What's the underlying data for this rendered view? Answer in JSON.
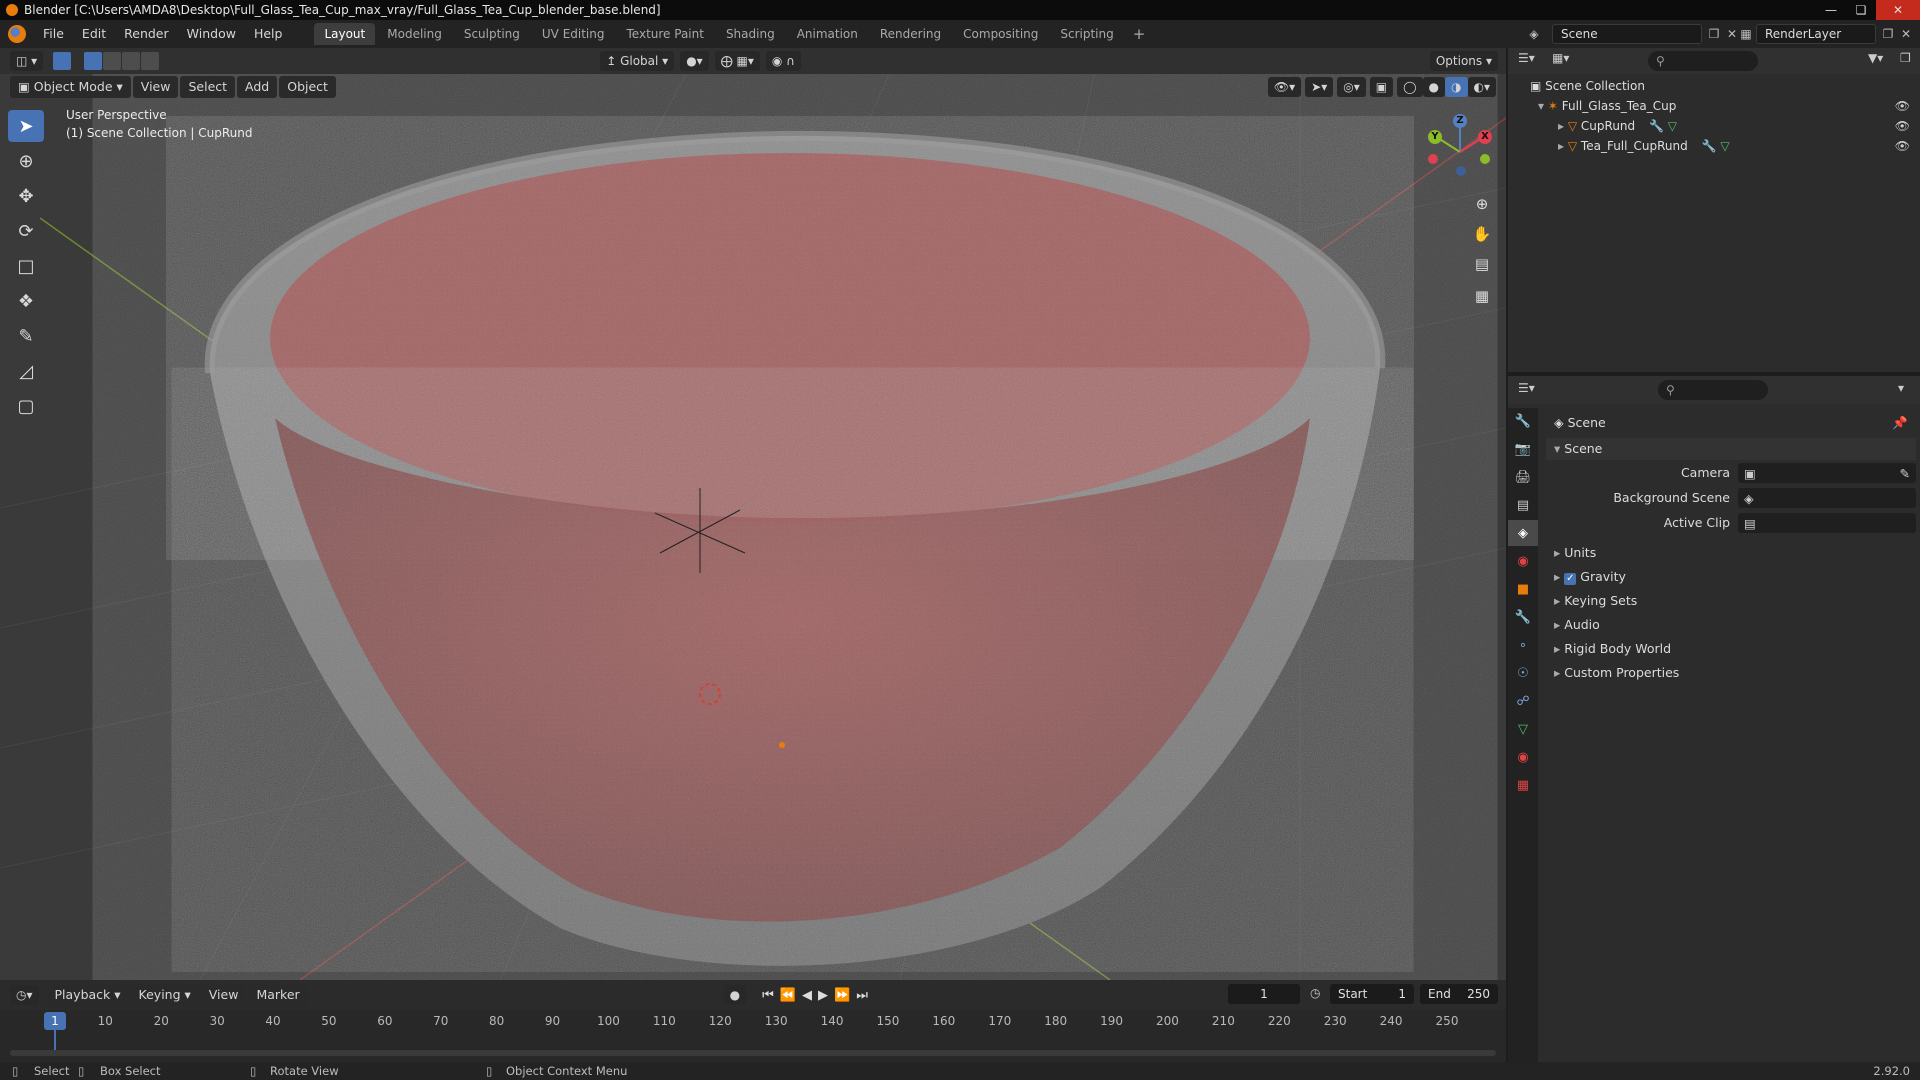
{
  "title_bar": {
    "text": "Blender [C:\\Users\\AMDA8\\Desktop\\Full_Glass_Tea_Cup_max_vray/Full_Glass_Tea_Cup_blender_base.blend]"
  },
  "menus": [
    "File",
    "Edit",
    "Render",
    "Window",
    "Help"
  ],
  "workspace_tabs": [
    "Layout",
    "Modeling",
    "Sculpting",
    "UV Editing",
    "Texture Paint",
    "Shading",
    "Animation",
    "Rendering",
    "Compositing",
    "Scripting"
  ],
  "active_workspace": "Layout",
  "scene_name": "Scene",
  "render_layer": "RenderLayer",
  "viewport": {
    "mode": "Object Mode",
    "menus": [
      "View",
      "Select",
      "Add",
      "Object"
    ],
    "transform_orientation": "Global",
    "options_label": "Options",
    "perspective_label": "User Perspective",
    "collection_label": "(1) Scene Collection | CupRund",
    "gizmo_axes": [
      "X",
      "Y",
      "Z"
    ]
  },
  "outliner": {
    "root": "Scene Collection",
    "collection": "Full_Glass_Tea_Cup",
    "objects": [
      "CupRund",
      "Tea_Full_CupRund"
    ]
  },
  "properties": {
    "header": "Scene",
    "panel": "Scene",
    "fields": [
      {
        "label": "Camera",
        "value": ""
      },
      {
        "label": "Background Scene",
        "value": ""
      },
      {
        "label": "Active Clip",
        "value": ""
      }
    ],
    "sections": [
      "Units",
      "Gravity",
      "Keying Sets",
      "Audio",
      "Rigid Body World",
      "Custom Properties"
    ],
    "gravity_checked": true
  },
  "timeline": {
    "menus": [
      "Playback",
      "Keying",
      "View",
      "Marker"
    ],
    "current_frame": "1",
    "start_label": "Start",
    "start": "1",
    "end_label": "End",
    "end": "250",
    "ticks": [
      "1",
      "10",
      "20",
      "30",
      "40",
      "50",
      "60",
      "70",
      "80",
      "90",
      "100",
      "110",
      "120",
      "130",
      "140",
      "150",
      "160",
      "170",
      "180",
      "190",
      "200",
      "210",
      "220",
      "230",
      "240",
      "250"
    ]
  },
  "status_bar": {
    "select": "Select",
    "box_select": "Box Select",
    "rotate_view": "Rotate View",
    "context_menu": "Object Context Menu",
    "version": "2.92.0"
  },
  "colors": {
    "accent": "#4772b3",
    "orange": "#e87d0d",
    "viewport_bg": "#3a3a3a"
  }
}
